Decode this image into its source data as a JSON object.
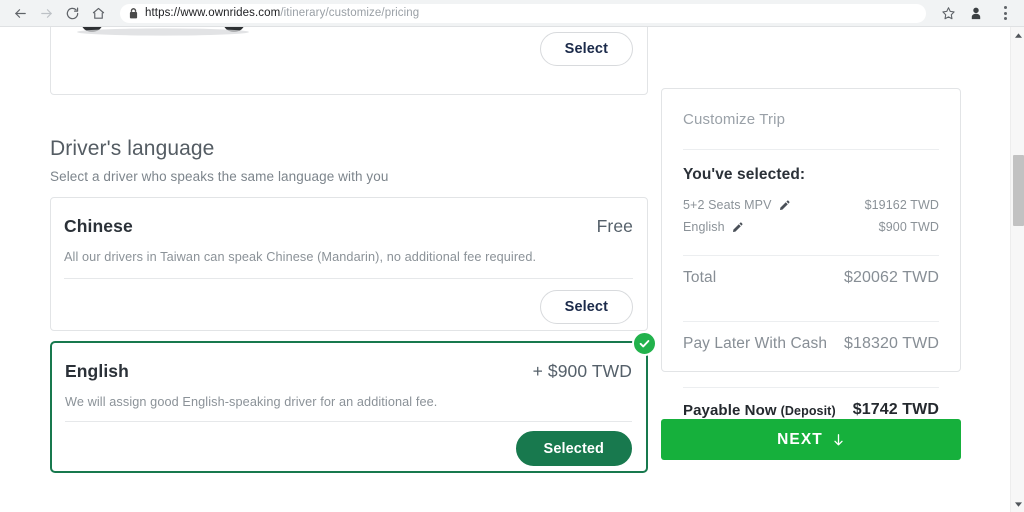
{
  "browser": {
    "back_label": "Back",
    "forward_label": "Forward",
    "reload_label": "Reload",
    "home_label": "Home",
    "url_domain": "https://www.ownrides.com",
    "url_path": "/itinerary/customize/pricing",
    "bookmark_label": "Bookmark this page",
    "profile_label": "Profile",
    "menu_label": "Customize and control"
  },
  "vehicle_card": {
    "select_label": "Select"
  },
  "section": {
    "title": "Driver's language",
    "subtitle": "Select a driver who speaks the same language with you"
  },
  "languages": [
    {
      "name": "Chinese",
      "price": "Free",
      "description": "All our drivers in Taiwan can speak Chinese (Mandarin), no additional fee required.",
      "action_label": "Select",
      "selected": false
    },
    {
      "name": "English",
      "price": "+ $900 TWD",
      "description": "We will assign good English-speaking driver for an additional fee.",
      "action_label": "Selected",
      "selected": true
    }
  ],
  "summary": {
    "panel_title": "Customize Trip",
    "selected_heading": "You've selected:",
    "items": [
      {
        "label": "5+2 Seats MPV",
        "value": "$19162 TWD"
      },
      {
        "label": "English",
        "value": "$900 TWD"
      }
    ],
    "total_label": "Total",
    "total_value": "$20062 TWD",
    "pay_later_label": "Pay Later With Cash",
    "pay_later_value": "$18320 TWD",
    "payable_label": "Payable Now",
    "payable_sublabel": "(Deposit)",
    "payable_value": "$1742 TWD"
  },
  "next_button": {
    "label": "NEXT"
  },
  "colors": {
    "brand_green": "#16b03c",
    "selected_green": "#18794e",
    "check_green": "#22b24c",
    "card_border": "#e2e4e6",
    "text_dark": "#2b3138",
    "text_muted": "#8b9298"
  }
}
